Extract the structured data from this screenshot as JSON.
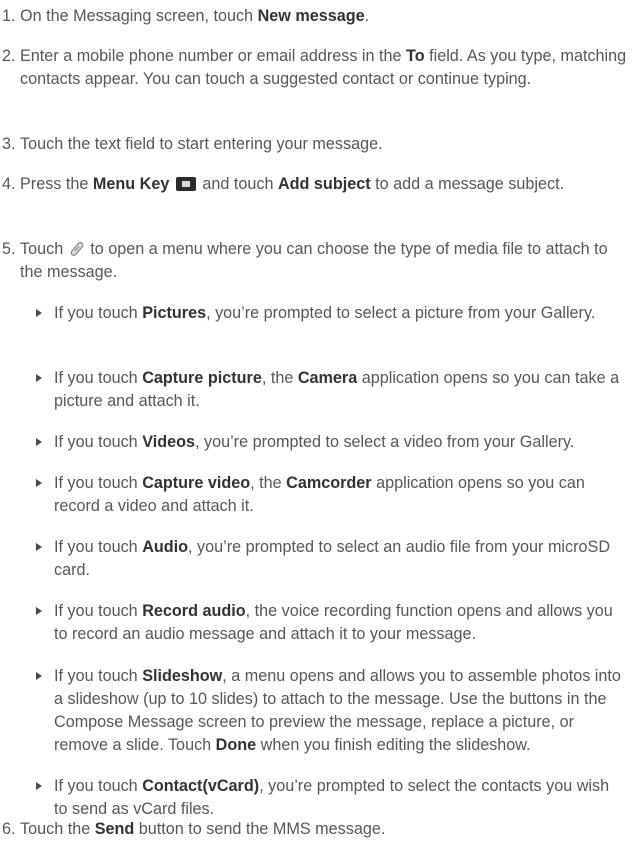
{
  "steps": [
    {
      "num": "1.",
      "parts": [
        "On the Messaging screen, touch ",
        "New message",
        "."
      ]
    },
    {
      "num": "2.",
      "parts": [
        "Enter a mobile phone number or email address in the ",
        "To",
        " field. As you type, matching contacts appear. You can touch a suggested contact or continue typing."
      ]
    },
    {
      "num": "3.",
      "parts": [
        "Touch the text field to start entering your message."
      ]
    },
    {
      "num": "4.",
      "parts": [
        "Press the ",
        "Menu Key",
        " and touch ",
        "Add subject",
        " to add a message subject."
      ]
    },
    {
      "num": "5.",
      "parts": [
        "Touch ",
        " to open a menu where you can choose the type of media file to attach to the message."
      ]
    },
    {
      "num": "6.",
      "parts": [
        "Touch the ",
        "Send",
        " button to send the MMS message."
      ]
    }
  ],
  "bullets": [
    {
      "parts": [
        "If you touch ",
        "Pictures",
        ", you’re prompted to select a picture from your Gallery."
      ]
    },
    {
      "parts": [
        "If you touch ",
        "Capture picture",
        ", the ",
        "Camera",
        " application opens so you can take a picture and attach it."
      ]
    },
    {
      "parts": [
        "If you touch ",
        "Videos",
        ", you’re prompted to select a video from your Gallery."
      ]
    },
    {
      "parts": [
        "If you touch ",
        "Capture video",
        ", the ",
        "Camcorder",
        " application opens so you can record a video and attach it."
      ]
    },
    {
      "parts": [
        "If you touch ",
        "Audio",
        ", you’re prompted to select an audio file from your microSD card."
      ]
    },
    {
      "parts": [
        "If you touch ",
        "Record audio",
        ", the voice recording function opens and allows you to record an audio message and attach it to your message."
      ]
    },
    {
      "parts": [
        "If you touch ",
        "Slideshow",
        ", a menu opens and allows you to assemble photos into a slideshow (up to 10 slides) to attach to the message. Use the buttons in the Compose Message screen to preview the message, replace a picture, or remove a slide. Touch ",
        "Done",
        " when you finish editing the slideshow."
      ]
    },
    {
      "parts": [
        "If you touch ",
        "Contact(vCard)",
        ", you’re prompted to select the contacts you wish to send as vCard files."
      ]
    }
  ],
  "icons": {
    "menu_key": "menu-key-icon",
    "attach": "paperclip-icon"
  }
}
